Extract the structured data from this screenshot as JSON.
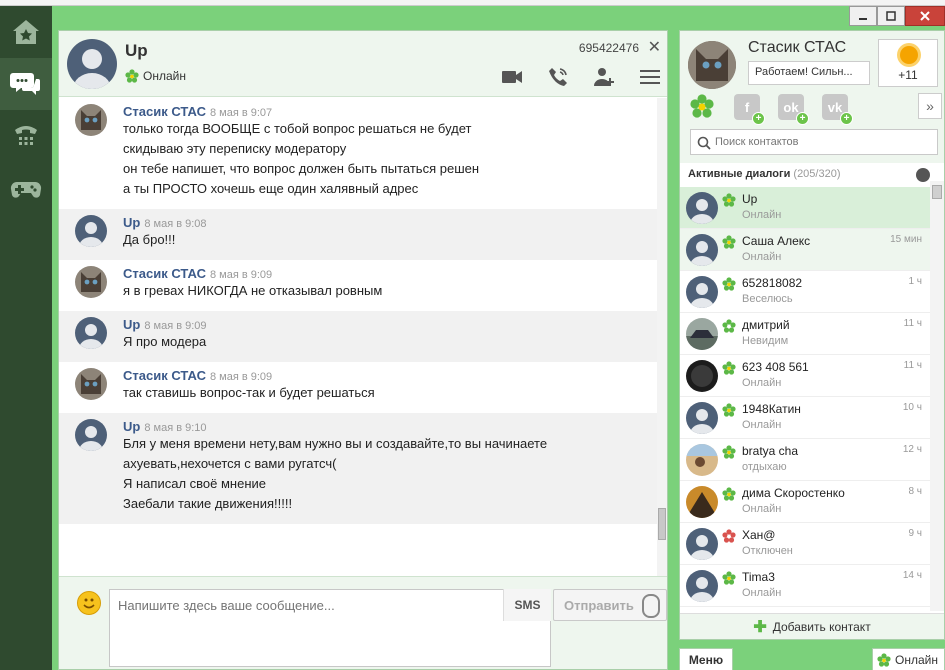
{
  "chat": {
    "contact_name": "Up",
    "contact_status": "Онлайн",
    "contact_uin": "695422476",
    "messages": [
      {
        "author": "Стасик СТАС",
        "time": "8 мая в 9:07",
        "lines": [
          "только тогда ВООБЩЕ с тобой вопрос решаться не будет",
          "скидываю эту переписку модератору",
          "он тебе напишет, что вопрос должен быть пытаться решен",
          "а ты ПРОСТО хочешь еще один халявный адрес"
        ]
      },
      {
        "author": "Up",
        "time": "8 мая в 9:08",
        "lines": [
          "Да бро!!!"
        ]
      },
      {
        "author": "Стасик СТАС",
        "time": "8 мая в 9:09",
        "lines": [
          "я в гревах НИКОГДА не отказывал ровным"
        ]
      },
      {
        "author": "Up",
        "time": "8 мая в 9:09",
        "lines": [
          "Я про модера"
        ]
      },
      {
        "author": "Стасик СТАС",
        "time": "8 мая в 9:09",
        "lines": [
          "так ставишь вопрос-так и будет решаться"
        ]
      },
      {
        "author": "Up",
        "time": "8 мая в 9:10",
        "lines": [
          "Бля у меня времени нету,вам нужно вы и создавайте,то вы начинаете",
          "ахуевать,нехочется с вами ругатсч(",
          "Я написал своё мнение",
          "Заебали такие движения!!!!!"
        ]
      }
    ],
    "input_placeholder": "Напишите здесь ваше сообщение...",
    "sms_label": "SMS",
    "send_label": "Отправить"
  },
  "me": {
    "name": "Стасик СТАС",
    "status_message": "Работаем! Сильн...",
    "weather": "+11"
  },
  "contacts_panel": {
    "search_placeholder": "Поиск контактов",
    "dialogs_title": "Активные диалоги",
    "dialogs_count": "(205/320)",
    "add_contact": "Добавить контакт",
    "contacts": [
      {
        "name": "Up",
        "status": "Онлайн",
        "time": ""
      },
      {
        "name": "Саша Алекс",
        "status": "Онлайн",
        "time": "15 мин"
      },
      {
        "name": "652818082",
        "status": "Веселюсь",
        "time": "1 ч"
      },
      {
        "name": "дмитрий",
        "status": "Невидим",
        "time": "11 ч"
      },
      {
        "name": "623 408 561",
        "status": "Онлайн",
        "time": "11 ч"
      },
      {
        "name": "1948Катин",
        "status": "Онлайн",
        "time": "10 ч"
      },
      {
        "name": "bratya cha",
        "status": "отдыхаю",
        "time": "12 ч"
      },
      {
        "name": "дима Скоростенко",
        "status": "Онлайн",
        "time": "8 ч"
      },
      {
        "name": "Хан@",
        "status": "Отключен",
        "time": "9 ч"
      },
      {
        "name": "Tima3",
        "status": "Онлайн",
        "time": "14 ч"
      }
    ]
  },
  "bottom": {
    "menu_label": "Меню",
    "status_label": "Онлайн"
  },
  "colors": {
    "frame_green": "#7bd17b",
    "sidebar_dark": "#2f4a2f",
    "link_blue": "#3c5a8a",
    "online_green": "#5cb847",
    "offline_red": "#d9534f"
  }
}
